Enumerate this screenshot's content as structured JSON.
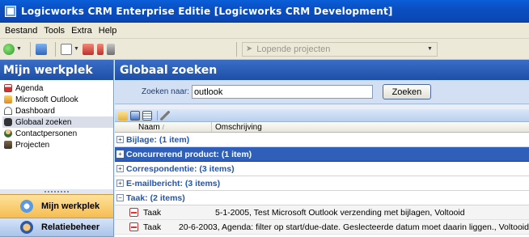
{
  "window": {
    "title": "Logicworks CRM Enterprise Editie  [Logicworks CRM Development]"
  },
  "menu": [
    "Bestand",
    "Tools",
    "Extra",
    "Help"
  ],
  "toolbar": {
    "dropdown_label": "Lopende projecten"
  },
  "left_pane": {
    "title": "Mijn werkplek",
    "items": [
      {
        "label": "Agenda",
        "icon": "calendar-icon"
      },
      {
        "label": "Microsoft Outlook",
        "icon": "outlook-icon"
      },
      {
        "label": "Dashboard",
        "icon": "dashboard-icon"
      },
      {
        "label": "Globaal zoeken",
        "icon": "binoculars-icon",
        "selected": true
      },
      {
        "label": "Contactpersonen",
        "icon": "person-icon"
      },
      {
        "label": "Projecten",
        "icon": "projects-icon"
      }
    ],
    "buttons": [
      {
        "label": "Mijn werkplek",
        "active": true
      },
      {
        "label": "Relatiebeheer",
        "active": false
      }
    ]
  },
  "main": {
    "title": "Globaal zoeken",
    "search": {
      "label": "Zoeken naar:",
      "value": "outlook",
      "button": "Zoeken"
    },
    "columns": [
      "Naam",
      "Omschrijving"
    ],
    "groups": [
      {
        "label": "Bijlage: (1 item)",
        "expanded": false,
        "selected": false
      },
      {
        "label": "Concurrerend product: (1 item)",
        "expanded": false,
        "selected": true
      },
      {
        "label": "Correspondentie: (3 items)",
        "expanded": false,
        "selected": false
      },
      {
        "label": "E-mailbericht: (3 items)",
        "expanded": false,
        "selected": false
      },
      {
        "label": "Taak: (2 items)",
        "expanded": true,
        "selected": false
      }
    ],
    "rows": [
      {
        "name": "Taak",
        "description": "5-1-2005, Test Microsoft Outlook verzending met bijlagen, Voltooid"
      },
      {
        "name": "Taak",
        "description": "20-6-2003, Agenda: filter op start/due-date. Geslecteerde datum moet daarin liggen., Voltooid"
      }
    ]
  }
}
